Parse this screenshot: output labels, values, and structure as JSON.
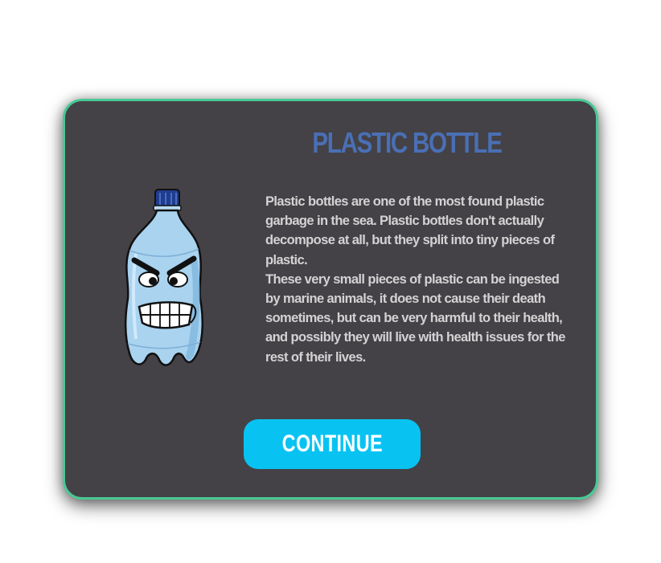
{
  "dialog": {
    "title": "PLASTIC BOTTLE",
    "description": [
      "Plastic bottles are one of the most found plastic garbage in the sea. Plastic bottles don't actually decompose at all, but they split into tiny pieces of plastic.",
      "These very small pieces of plastic can be ingested by marine animals, it does not cause their death sometimes, but can be very harmful to their health, and possibly they will live with health issues for the rest of their lives."
    ],
    "continue_label": "CONTINUE",
    "character_icon": "angry-plastic-bottle-icon"
  },
  "colors": {
    "panel_background": "#444246",
    "panel_border": "#48c995",
    "title": "#4a6fb5",
    "text": "#d5d2d4",
    "button": "#08c3f2",
    "button_text": "#ffffff"
  }
}
